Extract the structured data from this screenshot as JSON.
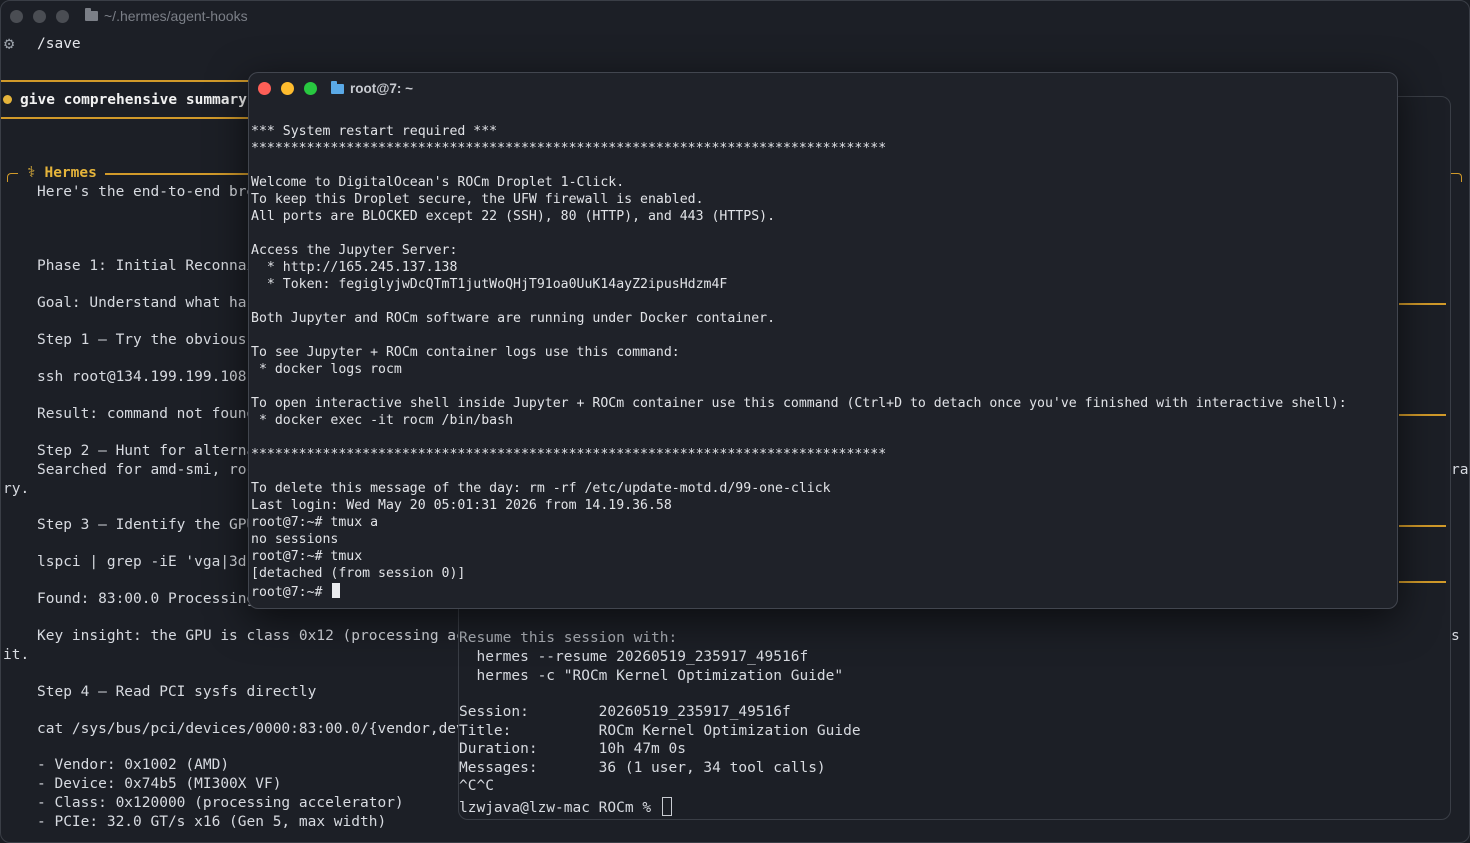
{
  "back_window": {
    "title": "~/.hermes/agent-hooks",
    "command": "/save",
    "prompt": "give comprehensive summary",
    "hermes_label": "⚕ Hermes",
    "lines": [
      "Here's the end-to-end bre",
      "Phase 1: Initial Reconnai",
      "Goal: Understand what har",
      "Step 1 — Try the obvious",
      "ssh root@134.199.199.108",
      "Result: command not found",
      "Step 2 — Hunt for alterna",
      "Searched for amd-smi, roc",
      "Step 3 — Identify the GPU",
      "lspci | grep -iE 'vga|3d|",
      "Found: 83:00.0 Processing",
      "Key insight: the GPU is class 0x12 (processing acc",
      "Step 4 — Read PCI sysfs directly",
      "cat /sys/bus/pci/devices/0000:83:00.0/{vendor,devi",
      "- Vendor: 0x1002 (AMD)",
      "- Device: 0x74b5 (MI300X VF)",
      "- Class: 0x120000 (processing accelerator)",
      "- PCIe: 32.0 GT/s x16 (Gen 5, max width)"
    ],
    "wrap_ry": "ry.",
    "wrap_it": "it.",
    "edge_ra": "ra",
    "edge_s": "s"
  },
  "mid_window": {
    "resume_header": "Resume this session with:",
    "resume_cmd1": "  hermes --resume 20260519_235917_49516f",
    "resume_cmd2": "  hermes -c \"ROCm Kernel Optimization Guide\"",
    "session_line": "Session:        20260519_235917_49516f",
    "title_line": "Title:          ROCm Kernel Optimization Guide",
    "duration_line": "Duration:       10h 47m 0s",
    "messages_line": "Messages:       36 (1 user, 34 tool calls)",
    "interrupt": "^C^C",
    "prompt": "lzwjava@lzw-mac ROCm % "
  },
  "front_window": {
    "title": "root@7: ~",
    "lines": [
      "*** System restart required ***",
      "********************************************************************************",
      "",
      "Welcome to DigitalOcean's ROCm Droplet 1-Click.",
      "To keep this Droplet secure, the UFW firewall is enabled.",
      "All ports are BLOCKED except 22 (SSH), 80 (HTTP), and 443 (HTTPS).",
      "",
      "Access the Jupyter Server:",
      "  * http://165.245.137.138",
      "  * Token: fegiglyjwDcQTmT1jutWoQHjT91oa0UuK14ayZ2ipusHdzm4F",
      "",
      "Both Jupyter and ROCm software are running under Docker container.",
      "",
      "To see Jupyter + ROCm container logs use this command:",
      " * docker logs rocm",
      "",
      "To open interactive shell inside Jupyter + ROCm container use this command (Ctrl+D to detach once you've finished with interactive shell):",
      " * docker exec -it rocm /bin/bash",
      "",
      "********************************************************************************",
      "",
      "To delete this message of the day: rm -rf /etc/update-motd.d/99-one-click",
      "Last login: Wed May 20 05:01:31 2026 from 14.19.36.58",
      "root@7:~# tmux a",
      "no sessions",
      "root@7:~# tmux",
      "[detached (from session 0)]"
    ],
    "prompt": "root@7:~# "
  },
  "colors": {
    "accent_gold": "#d19a2a",
    "close": "#fe5f57",
    "minimize": "#febc2e",
    "zoom": "#28c840",
    "inactive": "#4a4d53",
    "folder_blue": "#5aa9e6",
    "folder_gray": "#7b7f87"
  }
}
